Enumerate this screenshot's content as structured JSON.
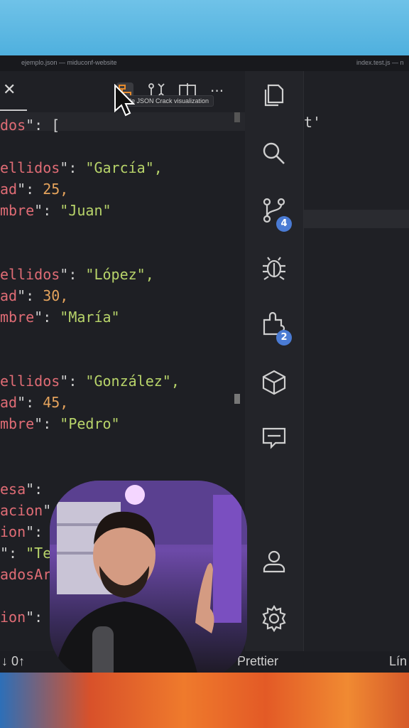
{
  "window": {
    "title_left": "ejemplo.json — miduconf-website",
    "title_right": "index.test.js — n"
  },
  "toolbar": {
    "close": "✕",
    "tooltip": "le JSON Crack visualization",
    "more": "···"
  },
  "editor": {
    "lines": [
      {
        "key": "dos",
        "sep": "\": [",
        "val": "",
        "kind": "p"
      },
      {
        "key": "ellidos",
        "sep": "\": ",
        "val": "\"García\",",
        "kind": "s"
      },
      {
        "key": "ad",
        "sep": "\": ",
        "val": "25,",
        "kind": "n"
      },
      {
        "key": "mbre",
        "sep": "\": ",
        "val": "\"Juan\"",
        "kind": "s"
      },
      {
        "key": "ellidos",
        "sep": "\": ",
        "val": "\"López\",",
        "kind": "s"
      },
      {
        "key": "ad",
        "sep": "\": ",
        "val": "30,",
        "kind": "n"
      },
      {
        "key": "mbre",
        "sep": "\": ",
        "val": "\"María\"",
        "kind": "s"
      },
      {
        "key": "ellidos",
        "sep": "\": ",
        "val": "\"González\",",
        "kind": "s"
      },
      {
        "key": "ad",
        "sep": "\": ",
        "val": "45,",
        "kind": "n"
      },
      {
        "key": "mbre",
        "sep": "\": ",
        "val": "\"Pedro\"",
        "kind": "s"
      },
      {
        "key": "esa",
        "sep": "\":",
        "val": "",
        "kind": "p"
      },
      {
        "key": "acion",
        "sep": "\"",
        "val": "",
        "kind": "p"
      },
      {
        "key": "ion",
        "sep": "\":",
        "val": "",
        "kind": "p"
      },
      {
        "key": "",
        "sep": "\": ",
        "val": "\"Te",
        "kind": "s"
      },
      {
        "key": "adosAr",
        "sep": "",
        "val": "",
        "kind": "p"
      },
      {
        "key": "ion",
        "sep": "\":",
        "val": "",
        "kind": "p"
      }
    ]
  },
  "rightpane": {
    "snippet": "t'"
  },
  "activity": {
    "scm_badge": "4",
    "extensions_badge": "2"
  },
  "status": {
    "sync": "↓ 0↑",
    "prettier": "Prettier",
    "line": "Lín"
  },
  "colors": {
    "accent": "#4a7bd4",
    "json_key": "#e06c75",
    "json_string": "#b8d46a",
    "json_number": "#e5a35c"
  }
}
